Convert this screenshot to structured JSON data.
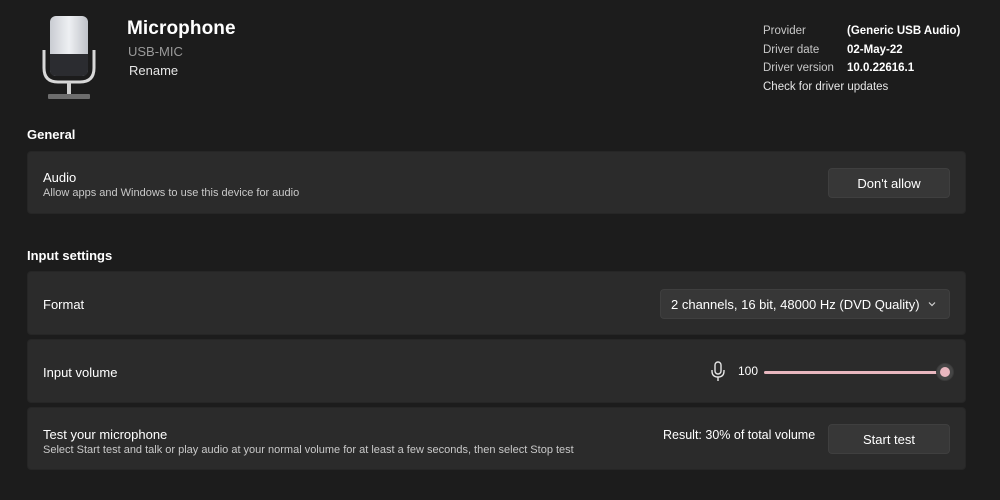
{
  "header": {
    "title": "Microphone",
    "subtitle": "USB-MIC",
    "rename_label": "Rename"
  },
  "driver": {
    "provider_label": "Provider",
    "provider_value": "(Generic USB Audio)",
    "date_label": "Driver date",
    "date_value": "02-May-22",
    "version_label": "Driver version",
    "version_value": "10.0.22616.1",
    "update_link": "Check for driver updates"
  },
  "general": {
    "heading": "General",
    "audio": {
      "title": "Audio",
      "description": "Allow apps and Windows to use this device for audio",
      "button_label": "Don't allow"
    }
  },
  "input_settings": {
    "heading": "Input settings",
    "format": {
      "title": "Format",
      "selected": "2 channels, 16 bit, 48000 Hz (DVD Quality)"
    },
    "volume": {
      "title": "Input volume",
      "value": "100",
      "level_percent": 100
    },
    "test": {
      "title": "Test your microphone",
      "description": "Select Start test and talk or play audio at your normal volume for at least a few seconds, then select Stop test",
      "result": "Result: 30% of total volume",
      "button_label": "Start test"
    }
  },
  "icons": {
    "device": "microphone-device-icon",
    "volume": "microphone-icon",
    "dropdown": "chevron-down-icon"
  },
  "colors": {
    "background": "#1c1c1c",
    "card": "#2b2b2b",
    "button": "#373737",
    "accent": "#e8b7bf"
  }
}
